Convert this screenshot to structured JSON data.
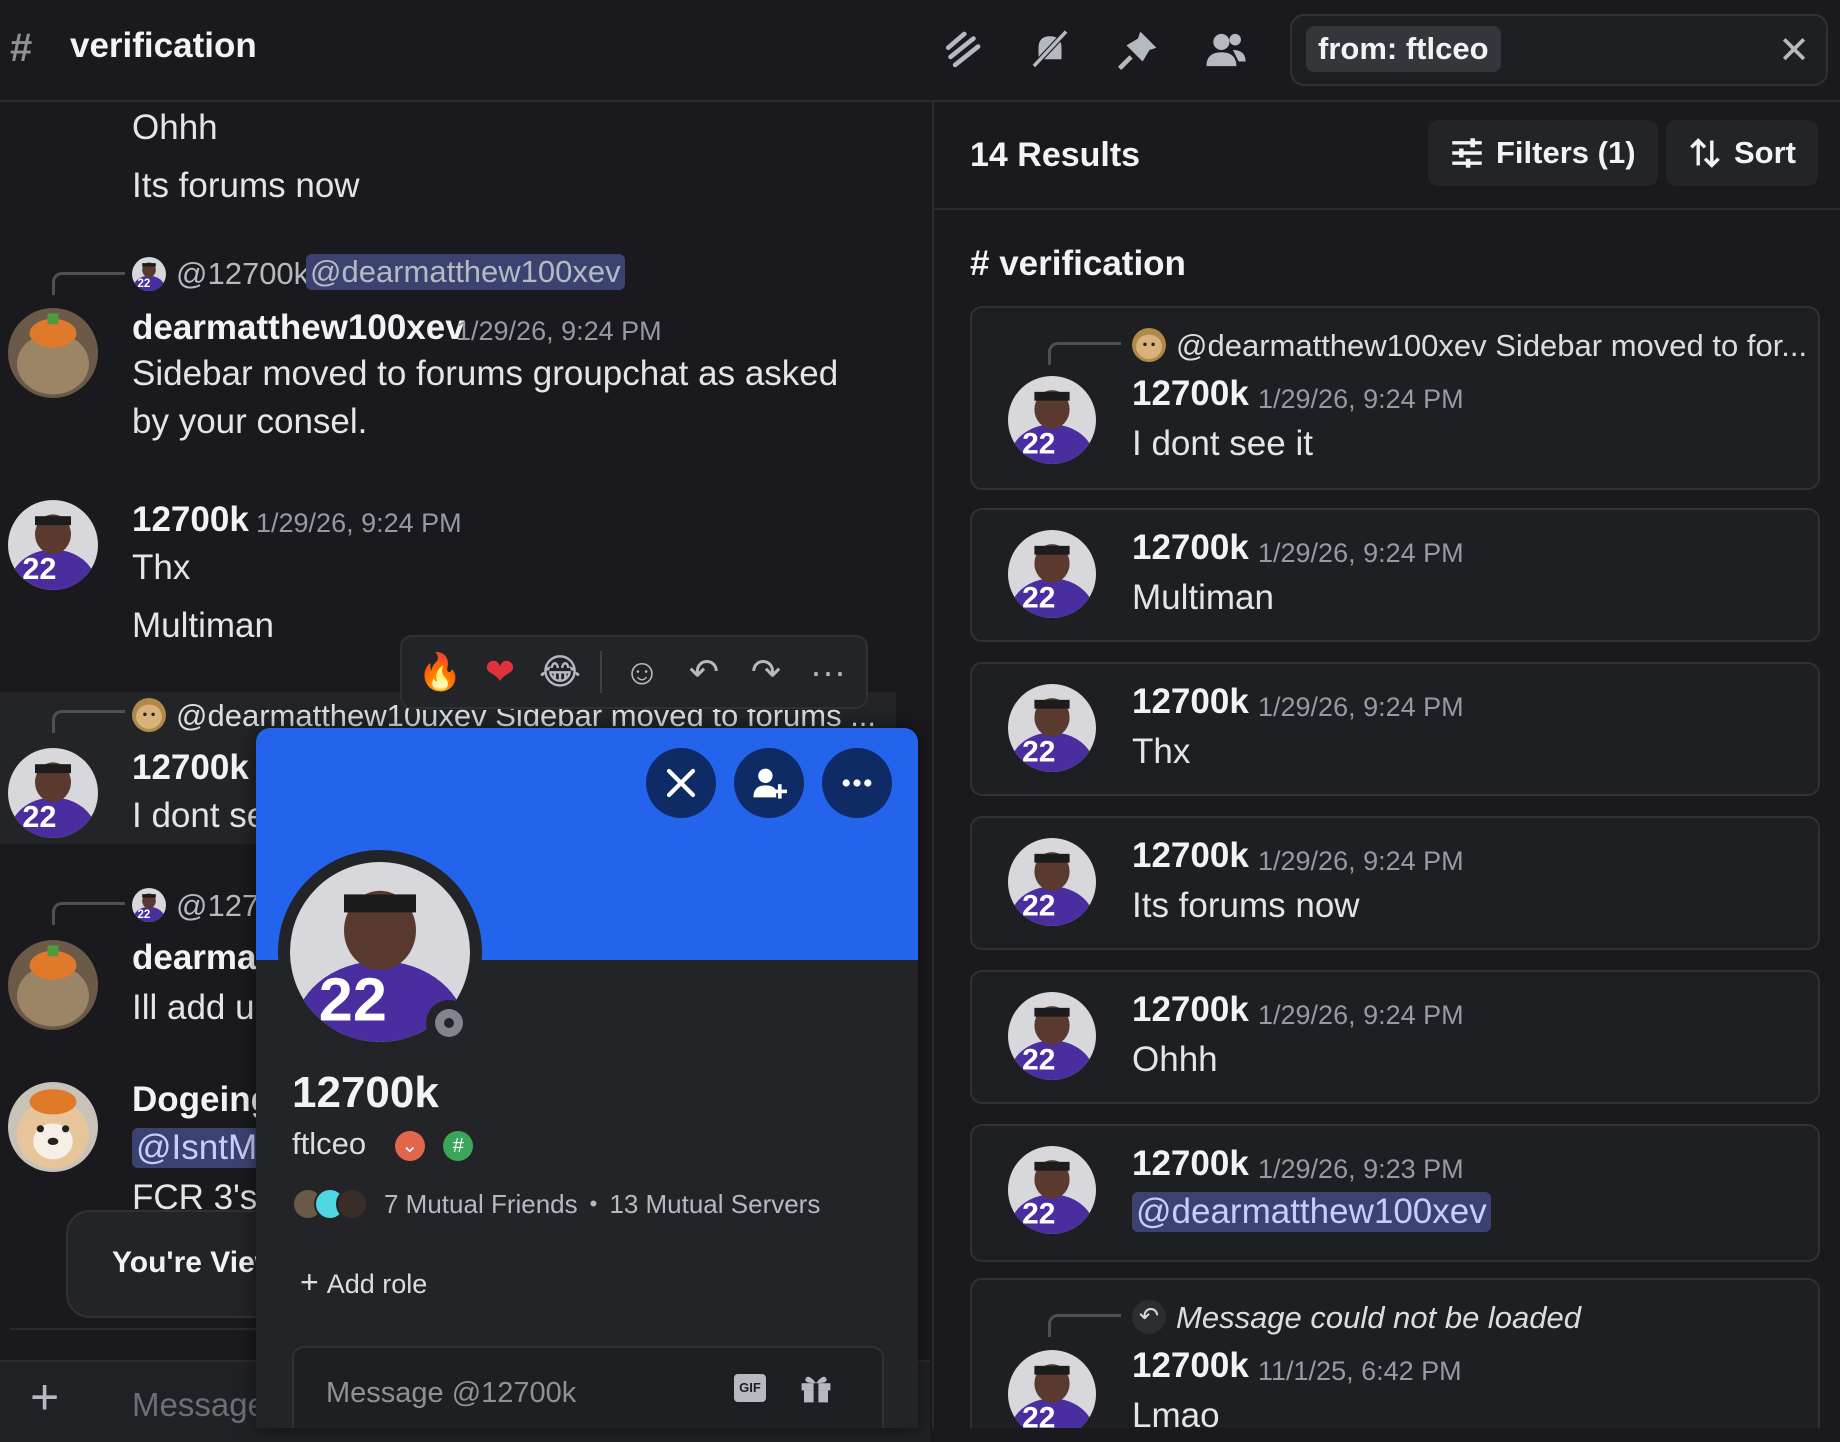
{
  "colors": {
    "background": "#1a1a1e",
    "banner": "#2463eb",
    "mention_bg": "#3c4270"
  },
  "header": {
    "channel": "verification",
    "icons": [
      "threads-icon",
      "mute-icon",
      "pin-icon",
      "members-icon"
    ],
    "search_chip": "from: ftlceo",
    "close_icon": "✕"
  },
  "chat": {
    "msg1_line1": "Ohhh",
    "msg1_line2": "Its forums now",
    "reply1_user": "@12700k",
    "reply1_mention": "@dearmatthew100xev",
    "msg2_user": "dearmatthew100xev",
    "msg2_time": "1/29/26, 9:24 PM",
    "msg2_line1": "Sidebar moved to forums groupchat as asked",
    "msg2_line2": "by your consel.",
    "msg3_user": "12700k",
    "msg3_time": "1/29/26, 9:24 PM",
    "msg3_line1": "Thx",
    "msg3_line2": "Multiman",
    "reply2_text": "@dearmatthew10uxev Sidebar moved to forums ...",
    "msg4_user": "12700k",
    "msg4_line1": "I dont se",
    "reply3_user": "@1270",
    "msg5_user": "dearmat",
    "msg5_line1": "Ill add u",
    "msg6_user": "Dogeing",
    "msg6_mention": "@IsntM",
    "msg6_line2": "FCR 3's",
    "viewing": "You're View",
    "input_placeholder": "Message",
    "plus": "+"
  },
  "reaction_bar": {
    "fire": "🔥",
    "heart": "❤",
    "laugh": "😂",
    "add_reaction": "☺",
    "reply": "↶",
    "forward": "↷",
    "more": "···"
  },
  "results": {
    "count": "14 Results",
    "filters": "Filters (1)",
    "sort": "Sort",
    "channel": "verification",
    "cards": [
      {
        "reply": "@dearmatthew100xev Sidebar moved to for...",
        "user": "12700k",
        "time": "1/29/26, 9:24 PM",
        "text": "I dont see it"
      },
      {
        "user": "12700k",
        "time": "1/29/26, 9:24 PM",
        "text": "Multiman"
      },
      {
        "user": "12700k",
        "time": "1/29/26, 9:24 PM",
        "text": "Thx"
      },
      {
        "user": "12700k",
        "time": "1/29/26, 9:24 PM",
        "text": "Its forums now"
      },
      {
        "user": "12700k",
        "time": "1/29/26, 9:24 PM",
        "text": "Ohhh"
      },
      {
        "user": "12700k",
        "time": "1/29/26, 9:23 PM",
        "text": "@dearmatthew100xev"
      },
      {
        "reply": "Message could not be loaded",
        "user": "12700k",
        "time": "11/1/25, 6:42 PM",
        "text": "Lmao"
      }
    ]
  },
  "profile": {
    "name": "12700k",
    "username": "ftlceo",
    "mutual_friends": "7 Mutual Friends",
    "mutual_servers": "13 Mutual Servers",
    "add_role": "Add role",
    "message_placeholder": "Message @12700k",
    "gif": "GIF"
  }
}
